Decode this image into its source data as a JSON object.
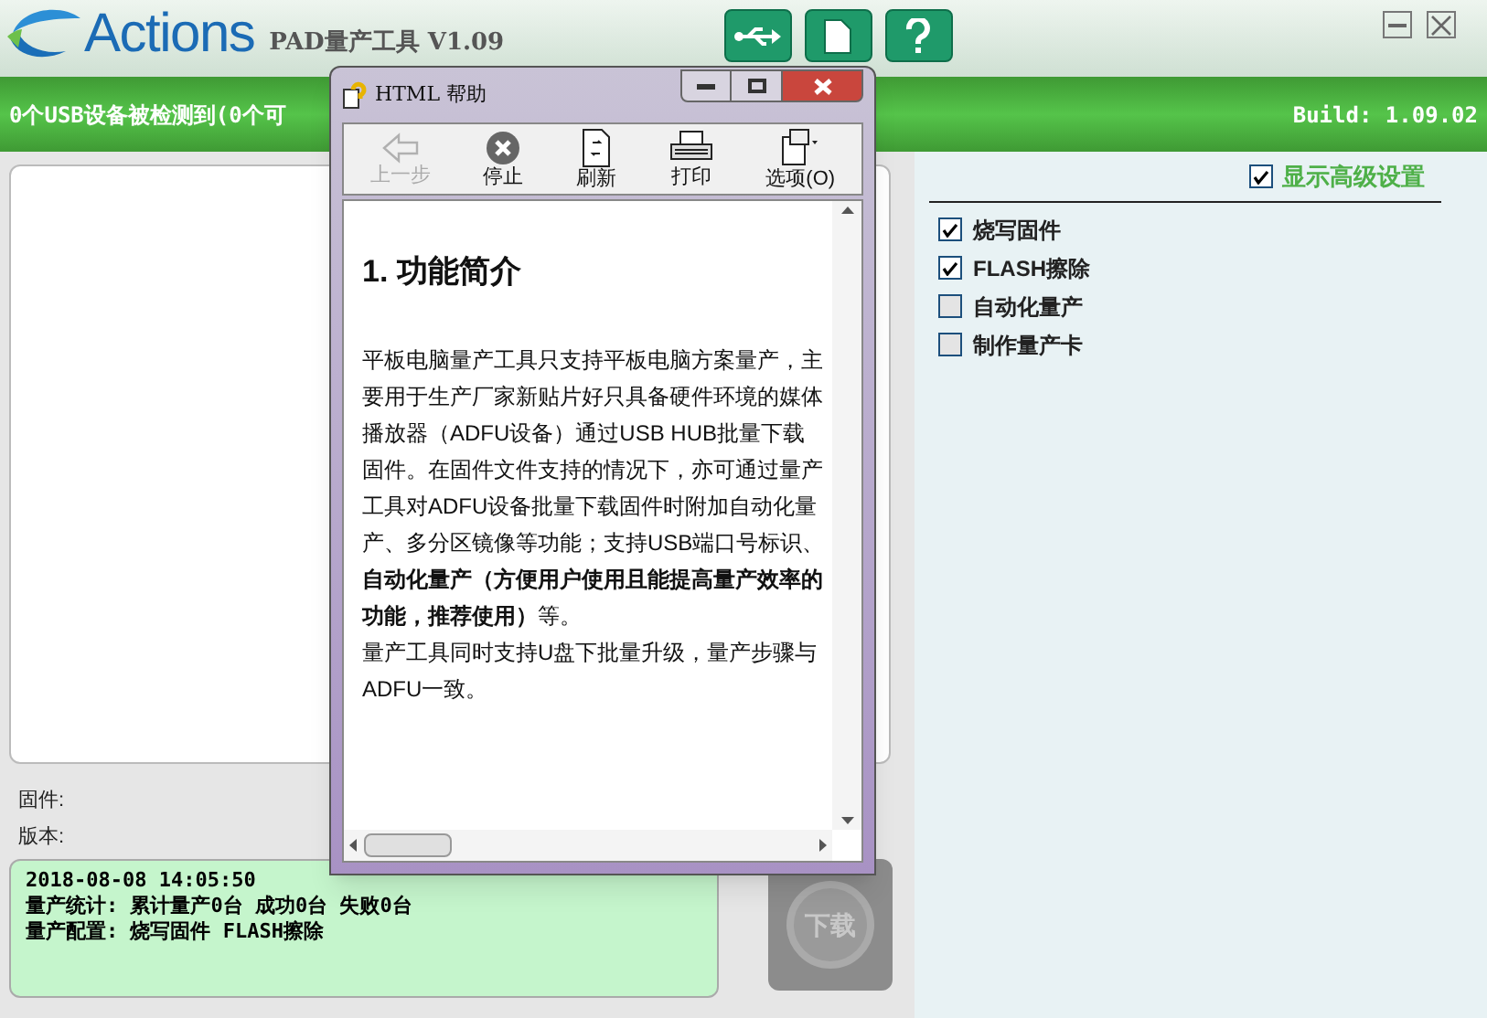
{
  "header": {
    "logo": "Actions",
    "title": "PAD量产工具 V1.09"
  },
  "status_bar": {
    "message": "0个USB设备被检测到(0个可",
    "build": "Build: 1.09.02"
  },
  "firmware": {
    "firmware_label": "固件:",
    "version_label": "版本:"
  },
  "log": {
    "lines": [
      "2018-08-08 14:05:50",
      "量产统计: 累计量产0台 成功0台 失败0台",
      "量产配置: 烧写固件 FLASH擦除"
    ]
  },
  "download_button": {
    "label": "下载",
    "disabled": true
  },
  "advanced": {
    "label": "显示高级设置",
    "checked": true
  },
  "options": [
    {
      "label": "烧写固件",
      "checked": true
    },
    {
      "label": "FLASH擦除",
      "checked": true
    },
    {
      "label": "自动化量产",
      "checked": false
    },
    {
      "label": "制作量产卡",
      "checked": false
    }
  ],
  "help_window": {
    "title": "HTML 帮助",
    "toolbar": [
      {
        "kind": "back",
        "label": "上一步",
        "disabled": true
      },
      {
        "kind": "stop",
        "label": "停止",
        "disabled": false
      },
      {
        "kind": "refresh",
        "label": "刷新",
        "disabled": false
      },
      {
        "kind": "print",
        "label": "打印",
        "disabled": false
      },
      {
        "kind": "options",
        "label": "选项(O)",
        "disabled": false
      }
    ],
    "heading": "1. 功能简介",
    "paragraphs": [
      "平板电脑量产工具只支持平板电脑方案量产，主要用于生产厂家新贴片好只具备硬件环境的媒体播放器（ADFU设备）通过USB HUB批量下载固件。在固件文件支持的情况下，亦可通过量产工具对ADFU设备批量下载固件时附加自动化量产、多分区镜像等功能；支持USB端口号标识、**自动化量产（方便用户使用且能提高量产效率的功能，推荐使用）**等。",
      "量产工具同时支持U盘下批量升级，量产步骤与ADFU一致。"
    ]
  }
}
